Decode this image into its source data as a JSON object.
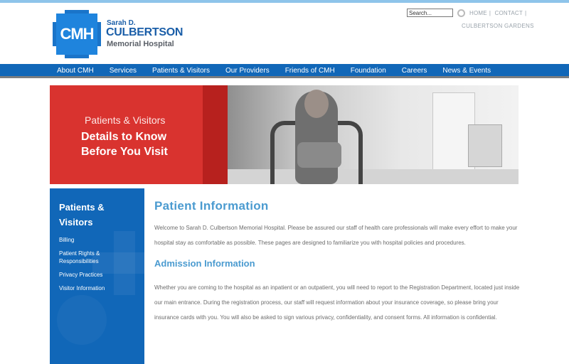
{
  "header": {
    "logo": {
      "mark": "CMH",
      "line1": "Sarah D.",
      "line2": "CULBERTSON",
      "line3": "Memorial Hospital"
    },
    "search": {
      "value": "Search..."
    },
    "util_links": [
      "HOME",
      "CONTACT"
    ],
    "sub_link": "CULBERTSON GARDENS"
  },
  "nav": {
    "items": [
      "About CMH",
      "Services",
      "Patients & Visitors",
      "Our Providers",
      "Friends of CMH",
      "Foundation",
      "Careers",
      "News & Events"
    ]
  },
  "banner": {
    "small": "Patients & Visitors",
    "big_line1": "Details to Know",
    "big_line2": "Before You Visit"
  },
  "sidebar": {
    "title": "Patients & Visitors",
    "items": [
      "Billing",
      "Patient Rights & Responsibilities",
      "Privacy Practices",
      "Visitor Information"
    ]
  },
  "content": {
    "title": "Patient Information",
    "intro": "Welcome to Sarah D. Culbertson Memorial Hospital. Please be assured our staff of health care professionals will make every effort to make your hospital stay as comfortable as possible. These pages are designed to familiarize you with hospital policies and procedures.",
    "section_title": "Admission Information",
    "section_body": "Whether you are coming to the hospital as an inpatient or an outpatient, you will need to report to the Registration Department, located just inside our main entrance. During the registration process, our staff will request information about your insurance coverage, so please bring your insurance cards with you. You will also be asked to sign various privacy, confidentiality, and consent forms. All information is confidential."
  },
  "colors": {
    "brand_blue": "#1167b8",
    "heading_blue": "#4b9bd0",
    "banner_red": "#d9332f"
  }
}
